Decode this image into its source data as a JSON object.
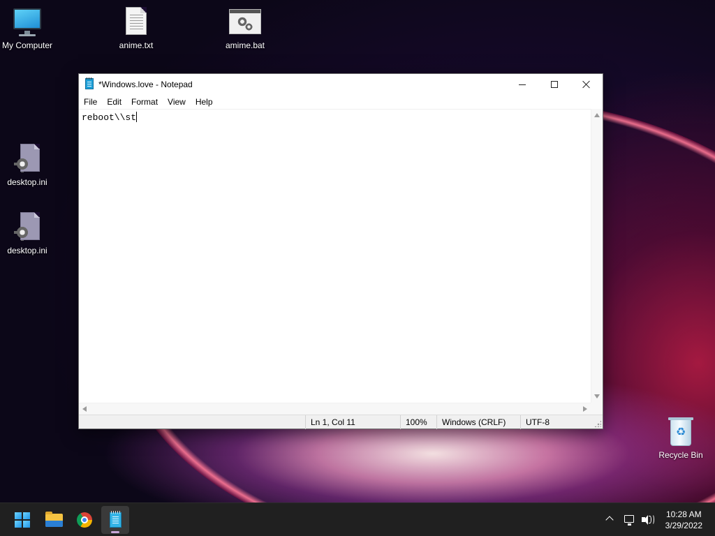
{
  "desktop": {
    "icons": [
      {
        "label": "My Computer",
        "icon": "monitor-icon"
      },
      {
        "label": "anime.txt",
        "icon": "text-file-icon"
      },
      {
        "label": "amime.bat",
        "icon": "batch-file-icon"
      },
      {
        "label": "desktop.ini",
        "icon": "settings-file-icon"
      },
      {
        "label": "desktop.ini",
        "icon": "settings-file-icon"
      },
      {
        "label": "Recycle Bin",
        "icon": "recycle-bin-icon"
      }
    ]
  },
  "notepad": {
    "title": "*Windows.love - Notepad",
    "menu": [
      "File",
      "Edit",
      "Format",
      "View",
      "Help"
    ],
    "content": "reboot\\\\st",
    "status": {
      "position": "Ln 1, Col 11",
      "zoom": "100%",
      "line_endings": "Windows (CRLF)",
      "encoding": "UTF-8"
    }
  },
  "taskbar": {
    "apps": [
      {
        "name": "start",
        "icon": "windows-logo-icon"
      },
      {
        "name": "file-explorer",
        "icon": "folder-icon"
      },
      {
        "name": "chrome",
        "icon": "chrome-icon"
      },
      {
        "name": "notepad",
        "icon": "notepad-icon",
        "active": true
      }
    ],
    "clock": {
      "time": "10:28 AM",
      "date": "3/29/2022"
    }
  }
}
